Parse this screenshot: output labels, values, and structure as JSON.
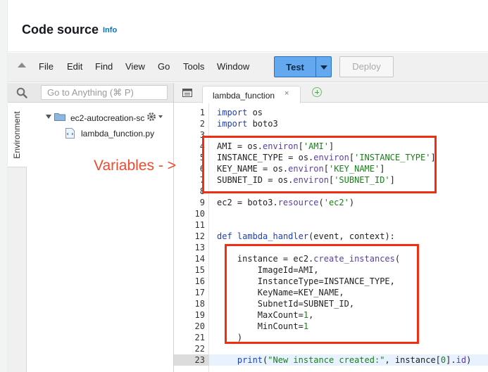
{
  "header": {
    "title": "Code source",
    "info_link": "Info"
  },
  "menu": {
    "items": [
      "File",
      "Edit",
      "Find",
      "View",
      "Go",
      "Tools",
      "Window"
    ],
    "test_label": "Test",
    "deploy_label": "Deploy"
  },
  "goto": {
    "placeholder": "Go to Anything (⌘ P)"
  },
  "sidebar": {
    "environment_tab": "Environment",
    "folder_name": "ec2-autocreation-sc",
    "file_name": "lambda_function.py"
  },
  "editor": {
    "tab_label": "lambda_function",
    "tab_close": "×",
    "current_line": 23,
    "line_numbers": [
      "1",
      "2",
      "3",
      "4",
      "5",
      "6",
      "7",
      "8",
      "9",
      "10",
      "11",
      "12",
      "13",
      "14",
      "15",
      "16",
      "17",
      "18",
      "19",
      "20",
      "21",
      "22",
      "23"
    ]
  },
  "annotation": {
    "variables_label": "Variables - >"
  },
  "colors": {
    "highlight_box": "#f22d10",
    "test_button": "#64a9f0",
    "info_link": "#0073bb"
  }
}
